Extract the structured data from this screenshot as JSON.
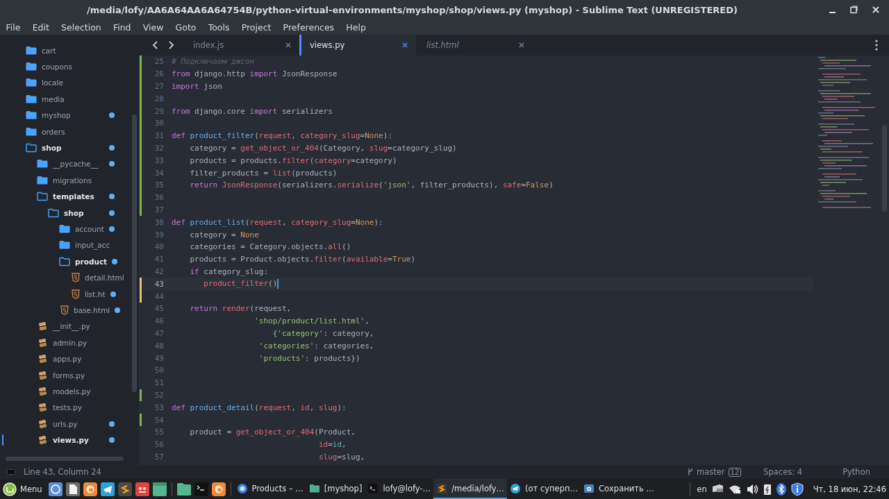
{
  "window": {
    "title": "/media/lofy/AA6A64AA6A64754B/python-virtual-environments/myshop/shop/views.py (myshop) - Sublime Text (UNREGISTERED)"
  },
  "menu": [
    "File",
    "Edit",
    "Selection",
    "Find",
    "View",
    "Goto",
    "Tools",
    "Project",
    "Preferences",
    "Help"
  ],
  "sidebar": {
    "items": [
      {
        "name": "cart",
        "kind": "folder",
        "expanded": false,
        "modified": false,
        "selected": false
      },
      {
        "name": "coupons",
        "kind": "folder",
        "expanded": false,
        "modified": false,
        "selected": false
      },
      {
        "name": "locale",
        "kind": "folder",
        "expanded": false,
        "modified": false,
        "selected": false
      },
      {
        "name": "media",
        "kind": "folder",
        "expanded": false,
        "modified": false,
        "selected": false
      },
      {
        "name": "myshop",
        "kind": "folder",
        "expanded": false,
        "modified": true,
        "selected": false
      },
      {
        "name": "orders",
        "kind": "folder",
        "expanded": false,
        "modified": false,
        "selected": false
      },
      {
        "name": "shop",
        "kind": "folder",
        "expanded": true,
        "modified": true,
        "selected": false,
        "children": [
          {
            "name": "__pycache__",
            "kind": "folder",
            "expanded": false,
            "modified": true,
            "selected": false
          },
          {
            "name": "migrations",
            "kind": "folder",
            "expanded": false,
            "modified": false,
            "selected": false
          },
          {
            "name": "templates",
            "kind": "folder",
            "expanded": true,
            "modified": true,
            "selected": false,
            "children": [
              {
                "name": "shop",
                "kind": "folder",
                "expanded": true,
                "modified": true,
                "selected": false,
                "children": [
                  {
                    "name": "account",
                    "kind": "folder",
                    "expanded": false,
                    "modified": true,
                    "selected": false
                  },
                  {
                    "name": "input_acc",
                    "kind": "folder",
                    "expanded": false,
                    "modified": false,
                    "selected": false
                  },
                  {
                    "name": "product",
                    "kind": "folder",
                    "expanded": true,
                    "modified": true,
                    "selected": false,
                    "children": [
                      {
                        "name": "detail.html",
                        "kind": "html",
                        "modified": false,
                        "selected": false
                      },
                      {
                        "name": "list.ht",
                        "kind": "html",
                        "modified": true,
                        "selected": false
                      }
                    ]
                  },
                  {
                    "name": "base.html",
                    "kind": "html",
                    "modified": true,
                    "selected": false
                  }
                ]
              }
            ]
          },
          {
            "name": "__init__.py",
            "kind": "python",
            "modified": false,
            "selected": false
          },
          {
            "name": "admin.py",
            "kind": "python",
            "modified": false,
            "selected": false
          },
          {
            "name": "apps.py",
            "kind": "python",
            "modified": false,
            "selected": false
          },
          {
            "name": "forms.py",
            "kind": "python",
            "modified": false,
            "selected": false
          },
          {
            "name": "models.py",
            "kind": "python",
            "modified": false,
            "selected": false
          },
          {
            "name": "tests.py",
            "kind": "python",
            "modified": false,
            "selected": false
          },
          {
            "name": "urls.py",
            "kind": "python",
            "modified": true,
            "selected": false
          },
          {
            "name": "views.py",
            "kind": "python",
            "modified": true,
            "selected": true
          }
        ]
      }
    ]
  },
  "tabs": [
    {
      "label": "index.js",
      "selected": false,
      "preview": false
    },
    {
      "label": "views.py",
      "selected": true,
      "preview": false
    },
    {
      "label": "list.html",
      "selected": false,
      "preview": true
    }
  ],
  "editor": {
    "lines": [
      {
        "number": "25",
        "added": true,
        "modified": false,
        "current": false,
        "tokens": [
          {
            "kind": "comment",
            "text": "# Подключаем джсон"
          }
        ]
      },
      {
        "number": "26",
        "added": true,
        "modified": false,
        "current": false,
        "tokens": [
          {
            "kind": "keyword",
            "text": "from"
          },
          {
            "kind": "plain",
            "text": " django.http "
          },
          {
            "kind": "keyword",
            "text": "import"
          },
          {
            "kind": "plain",
            "text": " JsonResponse"
          }
        ]
      },
      {
        "number": "27",
        "added": true,
        "modified": false,
        "current": false,
        "tokens": [
          {
            "kind": "keyword",
            "text": "import"
          },
          {
            "kind": "plain",
            "text": " json"
          }
        ]
      },
      {
        "number": "28",
        "added": true,
        "modified": false,
        "current": false
      },
      {
        "number": "29",
        "added": true,
        "modified": false,
        "current": false,
        "tokens": [
          {
            "kind": "keyword",
            "text": "from"
          },
          {
            "kind": "plain",
            "text": " django.core "
          },
          {
            "kind": "keyword",
            "text": "import"
          },
          {
            "kind": "plain",
            "text": " serializers"
          }
        ]
      },
      {
        "number": "30",
        "added": true,
        "modified": false,
        "current": false
      },
      {
        "number": "31",
        "added": true,
        "modified": false,
        "current": false,
        "tokens": [
          {
            "kind": "keyword",
            "text": "def "
          },
          {
            "kind": "function",
            "text": "product_filter"
          },
          {
            "kind": "plain",
            "text": "("
          },
          {
            "kind": "param",
            "text": "request"
          },
          {
            "kind": "plain",
            "text": ", "
          },
          {
            "kind": "param",
            "text": "category_slug"
          },
          {
            "kind": "plain",
            "text": "="
          },
          {
            "kind": "constant",
            "text": "None"
          },
          {
            "kind": "plain",
            "text": "):"
          }
        ]
      },
      {
        "number": "32",
        "added": true,
        "modified": false,
        "current": false,
        "tokens": [
          {
            "kind": "plain",
            "text": "    category = "
          },
          {
            "kind": "call",
            "text": "get_object_or_404"
          },
          {
            "kind": "plain",
            "text": "(Category, "
          },
          {
            "kind": "param",
            "text": "slug"
          },
          {
            "kind": "plain",
            "text": "=category_slug)"
          }
        ]
      },
      {
        "number": "33",
        "added": true,
        "modified": false,
        "current": false,
        "tokens": [
          {
            "kind": "plain",
            "text": "    products = products."
          },
          {
            "kind": "call",
            "text": "filter"
          },
          {
            "kind": "plain",
            "text": "("
          },
          {
            "kind": "param",
            "text": "category"
          },
          {
            "kind": "plain",
            "text": "=category)"
          }
        ]
      },
      {
        "number": "34",
        "added": true,
        "modified": false,
        "current": false,
        "tokens": [
          {
            "kind": "plain",
            "text": "    filter_products = "
          },
          {
            "kind": "call",
            "text": "list"
          },
          {
            "kind": "plain",
            "text": "(products)"
          }
        ]
      },
      {
        "number": "35",
        "added": true,
        "modified": false,
        "current": false,
        "tokens": [
          {
            "kind": "keyword",
            "text": "    return "
          },
          {
            "kind": "call",
            "text": "JsonResponse"
          },
          {
            "kind": "plain",
            "text": "(serializers."
          },
          {
            "kind": "call",
            "text": "serialize"
          },
          {
            "kind": "plain",
            "text": "("
          },
          {
            "kind": "string",
            "text": "'json'"
          },
          {
            "kind": "plain",
            "text": ", filter_products), "
          },
          {
            "kind": "param",
            "text": "safe"
          },
          {
            "kind": "plain",
            "text": "="
          },
          {
            "kind": "constant",
            "text": "False"
          },
          {
            "kind": "plain",
            "text": ")"
          }
        ]
      },
      {
        "number": "36",
        "added": true,
        "modified": false,
        "current": false
      },
      {
        "number": "37",
        "added": true,
        "modified": false,
        "current": false
      },
      {
        "number": "38",
        "added": false,
        "modified": false,
        "current": false,
        "tokens": [
          {
            "kind": "keyword",
            "text": "def "
          },
          {
            "kind": "function",
            "text": "product_list"
          },
          {
            "kind": "plain",
            "text": "("
          },
          {
            "kind": "param",
            "text": "request"
          },
          {
            "kind": "plain",
            "text": ", "
          },
          {
            "kind": "param",
            "text": "category_slug"
          },
          {
            "kind": "plain",
            "text": "="
          },
          {
            "kind": "constant",
            "text": "None"
          },
          {
            "kind": "plain",
            "text": "):"
          }
        ]
      },
      {
        "number": "39",
        "added": false,
        "modified": false,
        "current": false,
        "tokens": [
          {
            "kind": "plain",
            "text": "    category = "
          },
          {
            "kind": "constant",
            "text": "None"
          }
        ]
      },
      {
        "number": "40",
        "added": false,
        "modified": false,
        "current": false,
        "tokens": [
          {
            "kind": "plain",
            "text": "    categories = Category.objects."
          },
          {
            "kind": "call",
            "text": "all"
          },
          {
            "kind": "plain",
            "text": "()"
          }
        ]
      },
      {
        "number": "41",
        "added": false,
        "modified": false,
        "current": false,
        "tokens": [
          {
            "kind": "plain",
            "text": "    products = Product.objects."
          },
          {
            "kind": "call",
            "text": "filter"
          },
          {
            "kind": "plain",
            "text": "("
          },
          {
            "kind": "param",
            "text": "available"
          },
          {
            "kind": "plain",
            "text": "="
          },
          {
            "kind": "constant",
            "text": "True"
          },
          {
            "kind": "plain",
            "text": ")"
          }
        ]
      },
      {
        "number": "42",
        "added": false,
        "modified": false,
        "current": false,
        "tokens": [
          {
            "kind": "keyword",
            "text": "    if"
          },
          {
            "kind": "plain",
            "text": " category_slug:"
          }
        ]
      },
      {
        "number": "43",
        "added": false,
        "modified": true,
        "current": true,
        "tokens": [
          {
            "kind": "call",
            "text": "       product_filter"
          },
          {
            "kind": "plain",
            "text": "()"
          }
        ]
      },
      {
        "number": "44",
        "added": false,
        "modified": true,
        "current": false
      },
      {
        "number": "45",
        "added": false,
        "modified": false,
        "current": false,
        "tokens": [
          {
            "kind": "keyword",
            "text": "    return "
          },
          {
            "kind": "call",
            "text": "render"
          },
          {
            "kind": "plain",
            "text": "(request,"
          }
        ]
      },
      {
        "number": "46",
        "added": false,
        "modified": false,
        "current": false,
        "tokens": [
          {
            "kind": "string",
            "text": "                  'shop/product/list.html'"
          },
          {
            "kind": "plain",
            "text": ","
          }
        ]
      },
      {
        "number": "47",
        "added": false,
        "modified": false,
        "current": false,
        "tokens": [
          {
            "kind": "plain",
            "text": "                      {"
          },
          {
            "kind": "string",
            "text": "'category'"
          },
          {
            "kind": "plain",
            "text": ": category,"
          }
        ]
      },
      {
        "number": "48",
        "added": false,
        "modified": false,
        "current": false,
        "tokens": [
          {
            "kind": "string",
            "text": "                   'categories'"
          },
          {
            "kind": "plain",
            "text": ": categories,"
          }
        ]
      },
      {
        "number": "49",
        "added": false,
        "modified": false,
        "current": false,
        "tokens": [
          {
            "kind": "string",
            "text": "                   'products'"
          },
          {
            "kind": "plain",
            "text": ": products})"
          }
        ]
      },
      {
        "number": "50",
        "added": false,
        "modified": false,
        "current": false
      },
      {
        "number": "51",
        "added": false,
        "modified": false,
        "current": false
      },
      {
        "number": "52",
        "added": true,
        "modified": false,
        "current": false
      },
      {
        "number": "53",
        "added": false,
        "modified": false,
        "current": false,
        "tokens": [
          {
            "kind": "keyword",
            "text": "def "
          },
          {
            "kind": "function",
            "text": "product_detail"
          },
          {
            "kind": "plain",
            "text": "("
          },
          {
            "kind": "param",
            "text": "request"
          },
          {
            "kind": "plain",
            "text": ", "
          },
          {
            "kind": "param",
            "text": "id"
          },
          {
            "kind": "plain",
            "text": ", "
          },
          {
            "kind": "param",
            "text": "slug"
          },
          {
            "kind": "plain",
            "text": "):"
          }
        ]
      },
      {
        "number": "54",
        "added": true,
        "modified": false,
        "current": false
      },
      {
        "number": "55",
        "added": false,
        "modified": false,
        "current": false,
        "tokens": [
          {
            "kind": "plain",
            "text": "    product = "
          },
          {
            "kind": "call",
            "text": "get_object_or_404"
          },
          {
            "kind": "plain",
            "text": "(Product,"
          }
        ]
      },
      {
        "number": "56",
        "added": false,
        "modified": false,
        "current": false,
        "tokens": [
          {
            "kind": "param",
            "text": "                                id"
          },
          {
            "kind": "plain",
            "text": "="
          },
          {
            "kind": "variable",
            "text": "id"
          },
          {
            "kind": "plain",
            "text": ","
          }
        ]
      },
      {
        "number": "57",
        "added": false,
        "modified": false,
        "current": false,
        "tokens": [
          {
            "kind": "param",
            "text": "                                slug"
          },
          {
            "kind": "plain",
            "text": "=slug,"
          }
        ]
      }
    ]
  },
  "status_bar": {
    "position": "Line 43, Column 24",
    "branch": "master",
    "changes": "12",
    "indentation": "Spaces: 4",
    "syntax": "Python"
  },
  "taskbar": {
    "menu_label": "Menu",
    "windows": [
      {
        "label": "Products – …",
        "kind": "browser",
        "selected": false
      },
      {
        "label": "[myshop]",
        "kind": "folder",
        "selected": false
      },
      {
        "label": "lofy@lofy-…",
        "kind": "terminal",
        "selected": false
      },
      {
        "label": "/media/lofy…",
        "kind": "editor",
        "selected": true
      },
      {
        "label": "(от суперп…",
        "kind": "messenger",
        "selected": false
      },
      {
        "label": "Сохранить …",
        "kind": "screenshot",
        "selected": false
      }
    ],
    "keyboard_layout": "en",
    "clock": "Чт, 18 июн, 22:46"
  }
}
